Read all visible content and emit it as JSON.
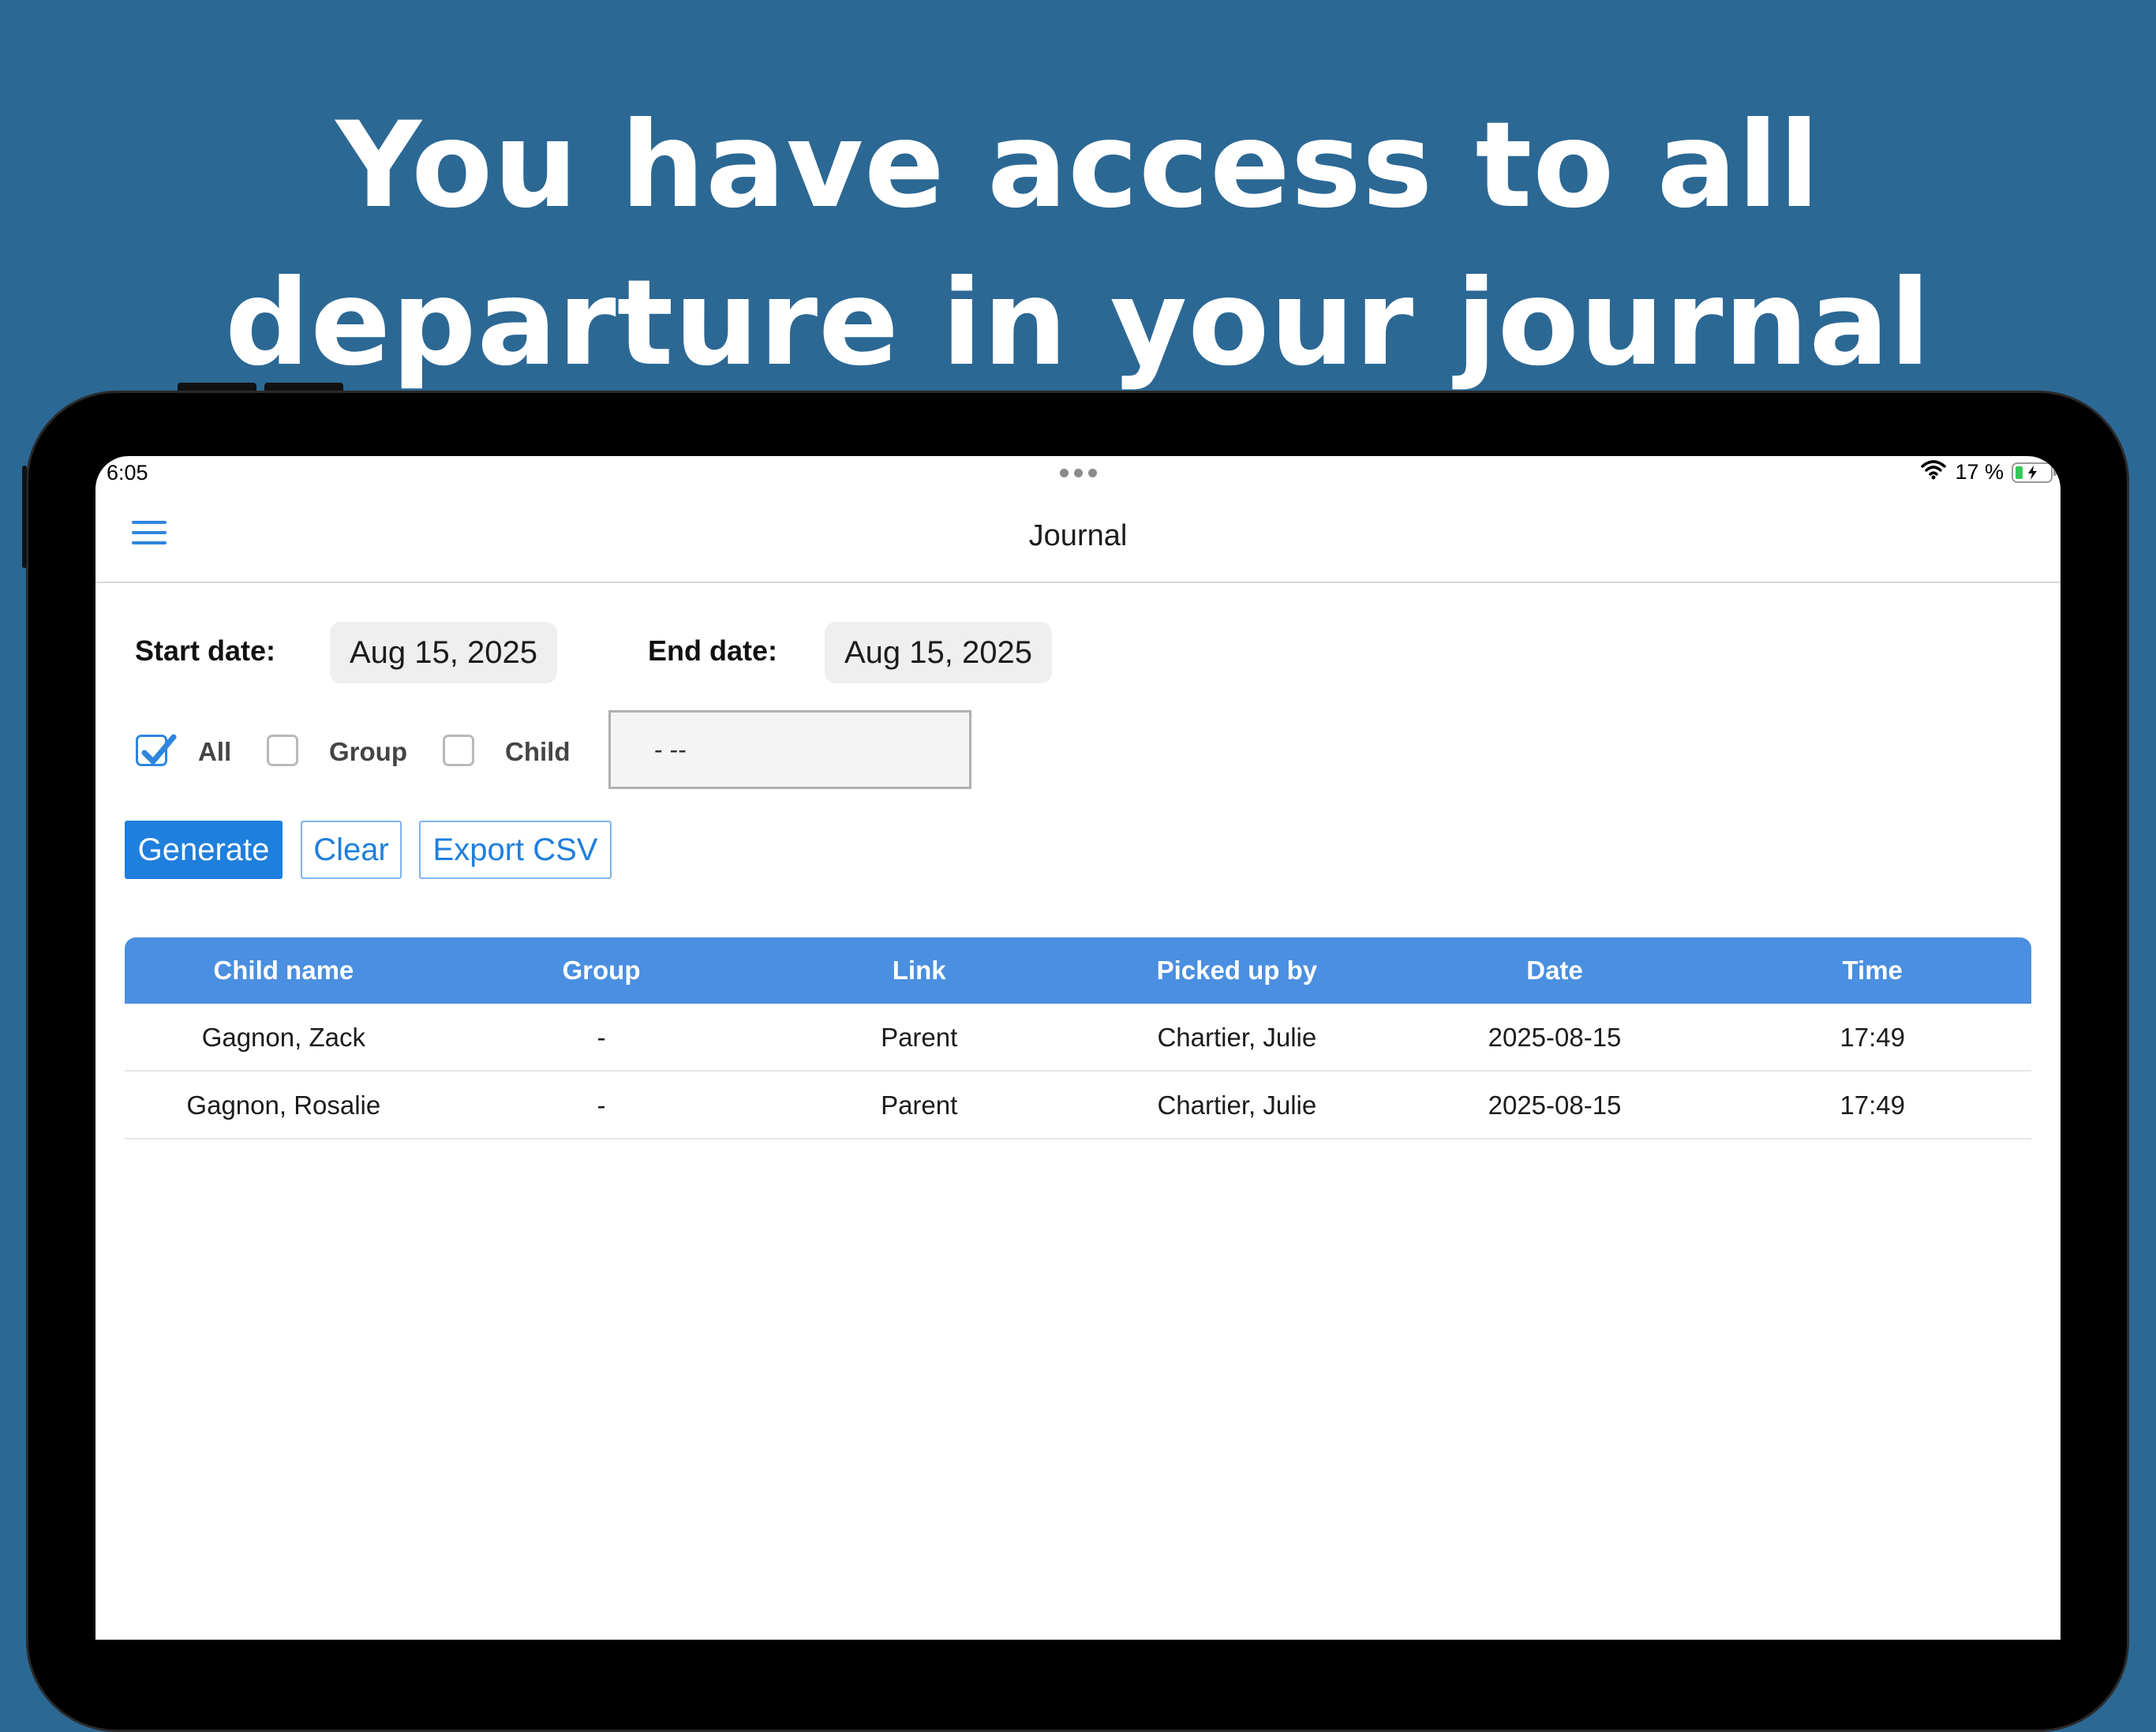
{
  "headline": {
    "line1": "You have access to all",
    "line2": "departure in your journal"
  },
  "statusbar": {
    "time": "6:05",
    "battery_text": "17 %",
    "battery_level_percent": 17,
    "icons": [
      "wifi-icon",
      "battery-charging-icon"
    ]
  },
  "navbar": {
    "title": "Journal",
    "menu_icon": "hamburger-menu-icon"
  },
  "filters": {
    "start_label": "Start date:",
    "start_value": "Aug 15, 2025",
    "end_label": "End date:",
    "end_value": "Aug 15, 2025",
    "options": [
      {
        "label": "All",
        "checked": true
      },
      {
        "label": "Group",
        "checked": false
      },
      {
        "label": "Child",
        "checked": false
      }
    ],
    "select_value": "- --"
  },
  "actions": {
    "generate": "Generate",
    "clear": "Clear",
    "export": "Export CSV"
  },
  "table": {
    "headers": [
      "Child name",
      "Group",
      "Link",
      "Picked up by",
      "Date",
      "Time"
    ],
    "rows": [
      [
        "Gagnon, Zack",
        "-",
        "Parent",
        "Chartier, Julie",
        "2025-08-15",
        "17:49"
      ],
      [
        "Gagnon, Rosalie",
        "-",
        "Parent",
        "Chartier, Julie",
        "2025-08-15",
        "17:49"
      ]
    ]
  },
  "colors": {
    "background": "#2c6894",
    "accent": "#1f7fdc",
    "table_header": "#4a8fe0"
  }
}
